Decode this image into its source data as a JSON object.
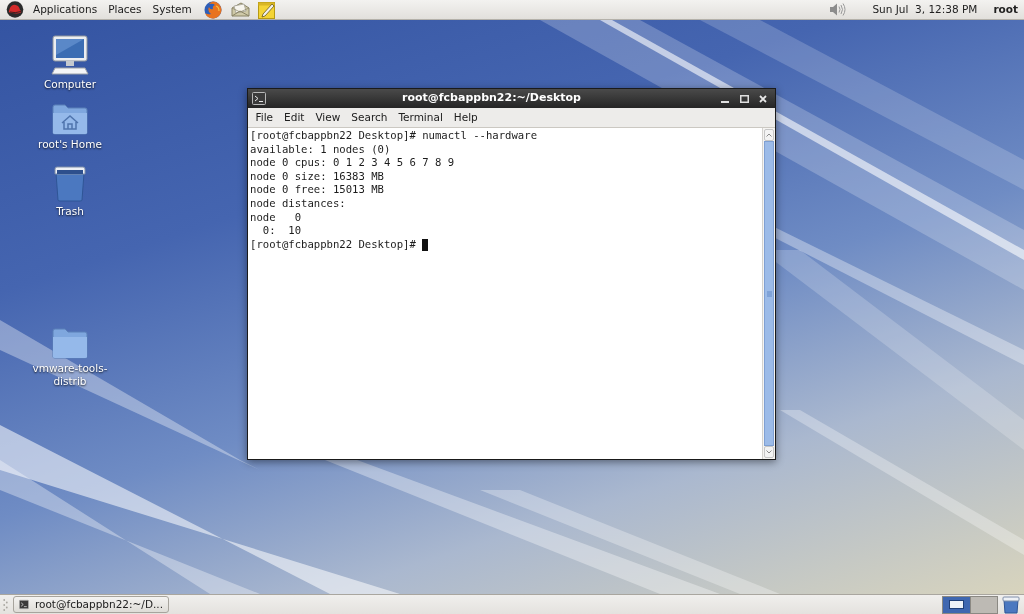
{
  "top_panel": {
    "menus": [
      "Applications",
      "Places",
      "System"
    ],
    "clock": "Sun Jul  3, 12:38 PM",
    "user": "root"
  },
  "desktop_icons": [
    {
      "label": "Computer",
      "kind": "computer"
    },
    {
      "label": "root's Home",
      "kind": "home"
    },
    {
      "label": "Trash",
      "kind": "trash"
    },
    {
      "label": "vmware-tools-distrib",
      "kind": "folder"
    }
  ],
  "terminal": {
    "title": "root@fcbappbn22:~/Desktop",
    "menu": [
      "File",
      "Edit",
      "View",
      "Search",
      "Terminal",
      "Help"
    ],
    "lines": [
      "[root@fcbappbn22 Desktop]# numactl --hardware",
      "available: 1 nodes (0)",
      "node 0 cpus: 0 1 2 3 4 5 6 7 8 9",
      "node 0 size: 16383 MB",
      "node 0 free: 15013 MB",
      "node distances:",
      "node   0",
      "  0:  10",
      "[root@fcbappbn22 Desktop]#"
    ]
  },
  "bottom_panel": {
    "tasks": [
      {
        "label": "root@fcbappbn22:~/D..."
      }
    ],
    "workspaces": [
      {
        "selected": true
      },
      {
        "selected": false
      }
    ]
  }
}
